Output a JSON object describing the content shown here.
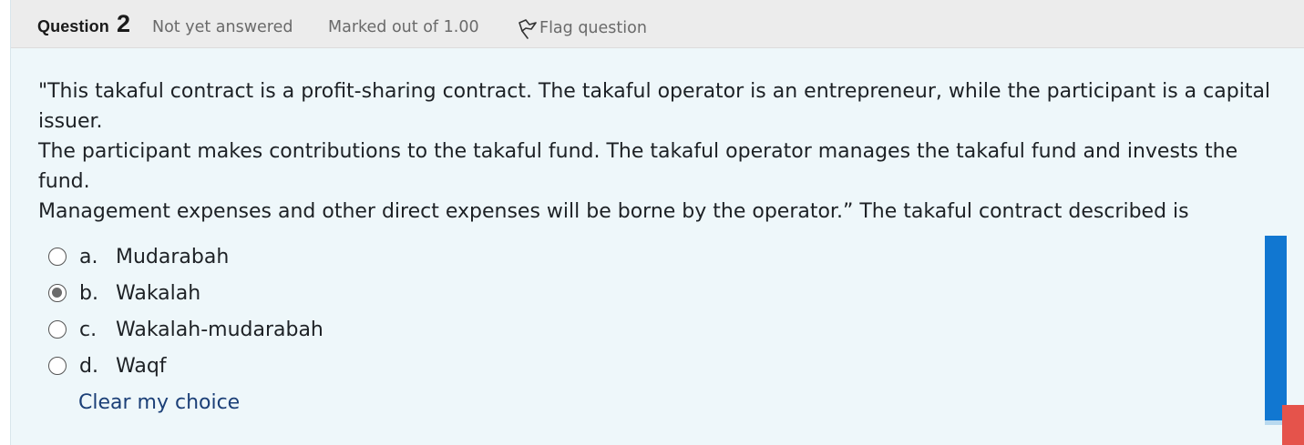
{
  "question": {
    "label": "Question",
    "number": "2",
    "state": "Not yet answered",
    "grade": "Marked out of 1.00",
    "flag_label": "Flag question",
    "text_lines": [
      "\"This takaful contract is a profit-sharing contract. The takaful operator is an entrepreneur, while the participant is a capital issuer.",
      "The participant makes contributions to the takaful fund. The takaful operator manages the takaful fund and invests the fund.",
      "Management expenses and other direct expenses will be borne by the operator.” The takaful contract described is"
    ]
  },
  "answers": [
    {
      "letter": "a.",
      "text": "Mudarabah",
      "selected": false
    },
    {
      "letter": "b.",
      "text": "Wakalah",
      "selected": true
    },
    {
      "letter": "c.",
      "text": "Wakalah-mudarabah",
      "selected": false
    },
    {
      "letter": "d.",
      "text": "Waqf",
      "selected": false
    }
  ],
  "clear_choice_label": "Clear my choice",
  "icons": {
    "flag": "flag-icon"
  },
  "colors": {
    "card_bg": "#eef7fa",
    "header_bg": "#ececec",
    "link": "#1b3f77",
    "scrollbar": "#1177d1",
    "corner_widget": "#e5534b"
  }
}
